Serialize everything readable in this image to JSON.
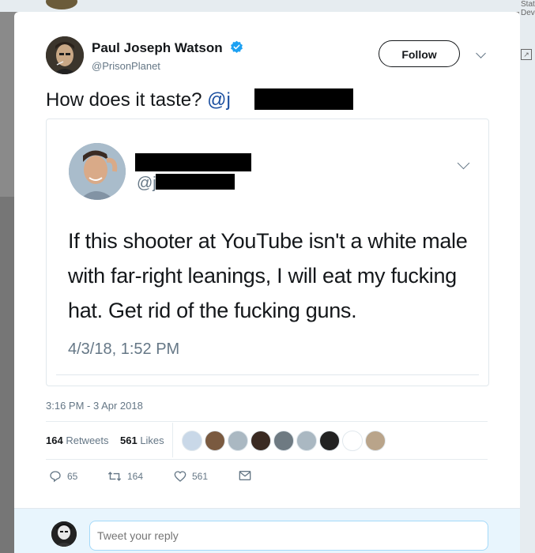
{
  "background": {
    "side_text": "Stat\nDev",
    "expand_icon": "expand-icon"
  },
  "tweet": {
    "author_name": "Paul Joseph Watson",
    "author_handle": "@PrisonPlanet",
    "follow_label": "Follow",
    "text_prefix": "How does it taste? ",
    "mention_prefix": "@j",
    "timestamp": "3:16 PM - 3 Apr 2018",
    "retweets_count": "164",
    "retweets_label": "Retweets",
    "likes_count": "561",
    "likes_label": "Likes",
    "liker_colors": [
      "#c9d8e8",
      "#7a5a40",
      "#aab8c2",
      "#3a2a22",
      "#6e7a82",
      "#aab8c2",
      "#222222",
      "#ffffff",
      "#b9a48a"
    ],
    "actions": {
      "reply_count": "65",
      "retweet_count": "164",
      "like_count": "561"
    }
  },
  "quoted_tweet": {
    "handle_prefix": "@j",
    "text": "If this shooter at YouTube isn't a white male with far-right leanings, I will eat my fucking hat. Get rid of the fucking guns.",
    "date": "4/3/18, 1:52 PM"
  },
  "reply": {
    "placeholder": "Tweet your reply"
  },
  "colors": {
    "verified": "#1da1f2",
    "mention": "#1b4fa0",
    "action_grey": "#657786"
  }
}
